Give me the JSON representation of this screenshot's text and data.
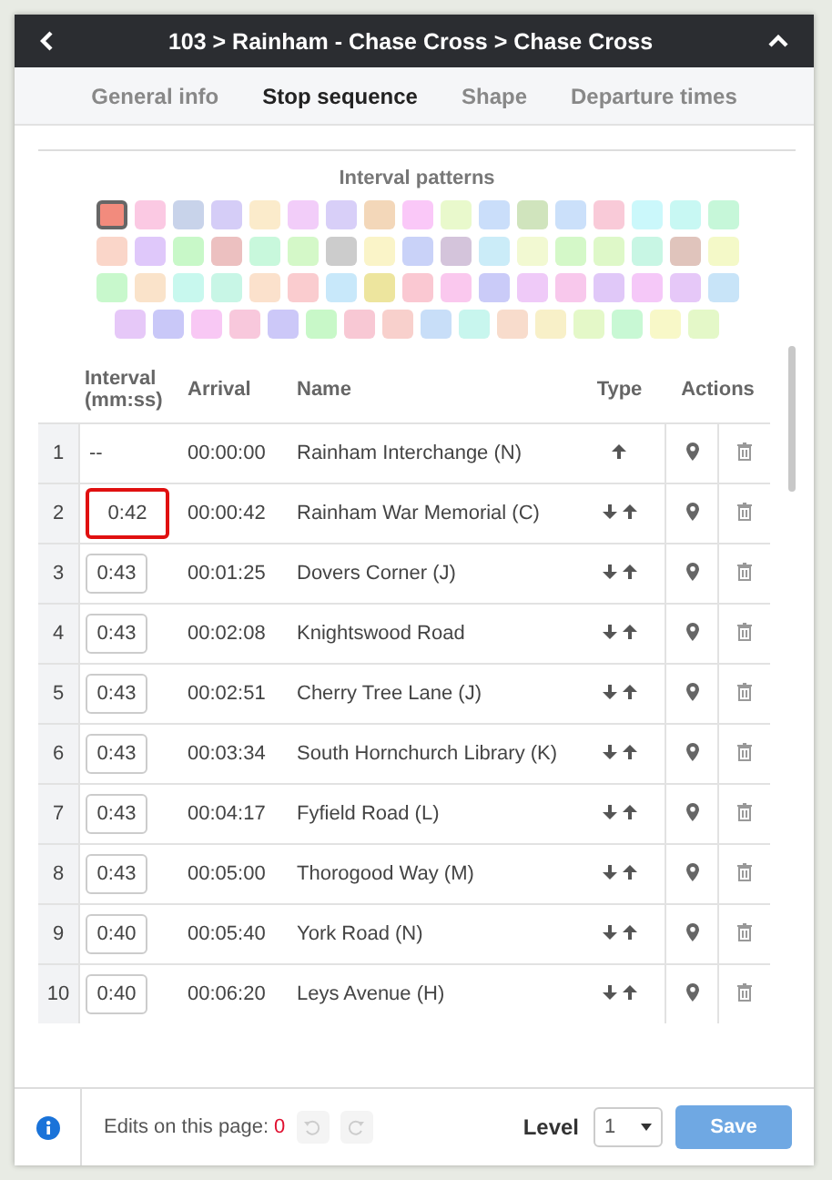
{
  "header": {
    "title": "103 > Rainham - Chase Cross > Chase Cross"
  },
  "tabs": [
    {
      "label": "General info",
      "selected": false
    },
    {
      "label": "Stop sequence",
      "selected": true
    },
    {
      "label": "Shape",
      "selected": false
    },
    {
      "label": "Departure times",
      "selected": false
    }
  ],
  "patterns": {
    "title": "Interval patterns",
    "rows": [
      [
        {
          "color": "#f28b7d",
          "selected": true
        },
        {
          "color": "#fbc9e3",
          "selected": false
        },
        {
          "color": "#c8d3ea",
          "selected": false
        },
        {
          "color": "#d5cdf7",
          "selected": false
        },
        {
          "color": "#fbebcb",
          "selected": false
        },
        {
          "color": "#f2cdf9",
          "selected": false
        },
        {
          "color": "#d8cff8",
          "selected": false
        },
        {
          "color": "#f3d7b9",
          "selected": false
        },
        {
          "color": "#fac8f8",
          "selected": false
        },
        {
          "color": "#e9f9cc",
          "selected": false
        },
        {
          "color": "#cadefa",
          "selected": false
        },
        {
          "color": "#d0e4bd",
          "selected": false
        },
        {
          "color": "#cbe0fa",
          "selected": false
        },
        {
          "color": "#f9cad8",
          "selected": false
        },
        {
          "color": "#cbf8fb",
          "selected": false
        },
        {
          "color": "#c8f8f3",
          "selected": false
        },
        {
          "color": "#c6f7d9",
          "selected": false
        }
      ],
      [
        {
          "color": "#fad6c9",
          "selected": false
        },
        {
          "color": "#dfc8fa",
          "selected": false
        },
        {
          "color": "#c8f8c8",
          "selected": false
        },
        {
          "color": "#ecc0c0",
          "selected": false
        },
        {
          "color": "#c8f8dc",
          "selected": false
        },
        {
          "color": "#d4f8c8",
          "selected": false
        },
        {
          "color": "#cccccc",
          "selected": false
        },
        {
          "color": "#faf4c8",
          "selected": false
        },
        {
          "color": "#c9d2f8",
          "selected": false
        },
        {
          "color": "#d4c4db",
          "selected": false
        },
        {
          "color": "#cbecf8",
          "selected": false
        },
        {
          "color": "#f2f9d2",
          "selected": false
        },
        {
          "color": "#d4f8c8",
          "selected": false
        },
        {
          "color": "#def8c8",
          "selected": false
        },
        {
          "color": "#c8f6e4",
          "selected": false
        },
        {
          "color": "#e0c4bc",
          "selected": false
        },
        {
          "color": "#f4f9c8",
          "selected": false
        }
      ],
      [
        {
          "color": "#c8f8cc",
          "selected": false
        },
        {
          "color": "#fae3ca",
          "selected": false
        },
        {
          "color": "#c8f8ee",
          "selected": false
        },
        {
          "color": "#c8f6e6",
          "selected": false
        },
        {
          "color": "#fbe1cc",
          "selected": false
        },
        {
          "color": "#facccf",
          "selected": false
        },
        {
          "color": "#c8e8fa",
          "selected": false
        },
        {
          "color": "#ede59e",
          "selected": false
        },
        {
          "color": "#fac8d2",
          "selected": false
        },
        {
          "color": "#fac8ee",
          "selected": false
        },
        {
          "color": "#cacbf8",
          "selected": false
        },
        {
          "color": "#efcaf8",
          "selected": false
        },
        {
          "color": "#f8c8ec",
          "selected": false
        },
        {
          "color": "#e0c8f8",
          "selected": false
        },
        {
          "color": "#f5c8f8",
          "selected": false
        },
        {
          "color": "#e6c8f8",
          "selected": false
        },
        {
          "color": "#c8e4f8",
          "selected": false
        }
      ],
      [
        {
          "color": "#e6c8f8",
          "selected": false
        },
        {
          "color": "#c9c8f8",
          "selected": false
        },
        {
          "color": "#f8c8f4",
          "selected": false
        },
        {
          "color": "#f8c8dc",
          "selected": false
        },
        {
          "color": "#ccc8f8",
          "selected": false
        },
        {
          "color": "#c8f8c8",
          "selected": false
        },
        {
          "color": "#f8c8d4",
          "selected": false
        },
        {
          "color": "#f8d0cc",
          "selected": false
        },
        {
          "color": "#c8def8",
          "selected": false
        },
        {
          "color": "#c8f6ee",
          "selected": false
        },
        {
          "color": "#f8dccc",
          "selected": false
        },
        {
          "color": "#f8f0c8",
          "selected": false
        },
        {
          "color": "#e4f8c8",
          "selected": false
        },
        {
          "color": "#c8f8d4",
          "selected": false
        },
        {
          "color": "#f8f8c8",
          "selected": false
        },
        {
          "color": "#e4f8c8",
          "selected": false
        }
      ]
    ]
  },
  "table": {
    "columns": [
      {
        "label": "Interval (mm:ss)"
      },
      {
        "label": "Arrival"
      },
      {
        "label": "Name"
      },
      {
        "label": "Type"
      },
      {
        "label": "Actions"
      }
    ],
    "rows": [
      {
        "number": "1",
        "interval": "--",
        "arrival": "00:00:00",
        "name": "Rainham Interchange (N)",
        "kind": "up",
        "highlighted": false
      },
      {
        "number": "2",
        "interval": "0:42",
        "arrival": "00:00:42",
        "name": "Rainham War Memorial (C)",
        "kind": "both",
        "highlighted": true
      },
      {
        "number": "3",
        "interval": "0:43",
        "arrival": "00:01:25",
        "name": "Dovers Corner (J)",
        "kind": "both",
        "highlighted": false
      },
      {
        "number": "4",
        "interval": "0:43",
        "arrival": "00:02:08",
        "name": "Knightswood Road",
        "kind": "both",
        "highlighted": false
      },
      {
        "number": "5",
        "interval": "0:43",
        "arrival": "00:02:51",
        "name": "Cherry Tree Lane (J)",
        "kind": "both",
        "highlighted": false
      },
      {
        "number": "6",
        "interval": "0:43",
        "arrival": "00:03:34",
        "name": "South Hornchurch Library (K)",
        "kind": "both",
        "highlighted": false
      },
      {
        "number": "7",
        "interval": "0:43",
        "arrival": "00:04:17",
        "name": "Fyfield Road (L)",
        "kind": "both",
        "highlighted": false
      },
      {
        "number": "8",
        "interval": "0:43",
        "arrival": "00:05:00",
        "name": "Thorogood Way (M)",
        "kind": "both",
        "highlighted": false
      },
      {
        "number": "9",
        "interval": "0:40",
        "arrival": "00:05:40",
        "name": "York Road (N)",
        "kind": "both",
        "highlighted": false
      },
      {
        "number": "10",
        "interval": "0:40",
        "arrival": "00:06:20",
        "name": "Leys Avenue (H)",
        "kind": "both",
        "highlighted": false
      }
    ]
  },
  "footer": {
    "edits_label": "Edits on this page:",
    "edits_count": "0",
    "level_label": "Level",
    "level_value": "1",
    "save": "Save"
  }
}
